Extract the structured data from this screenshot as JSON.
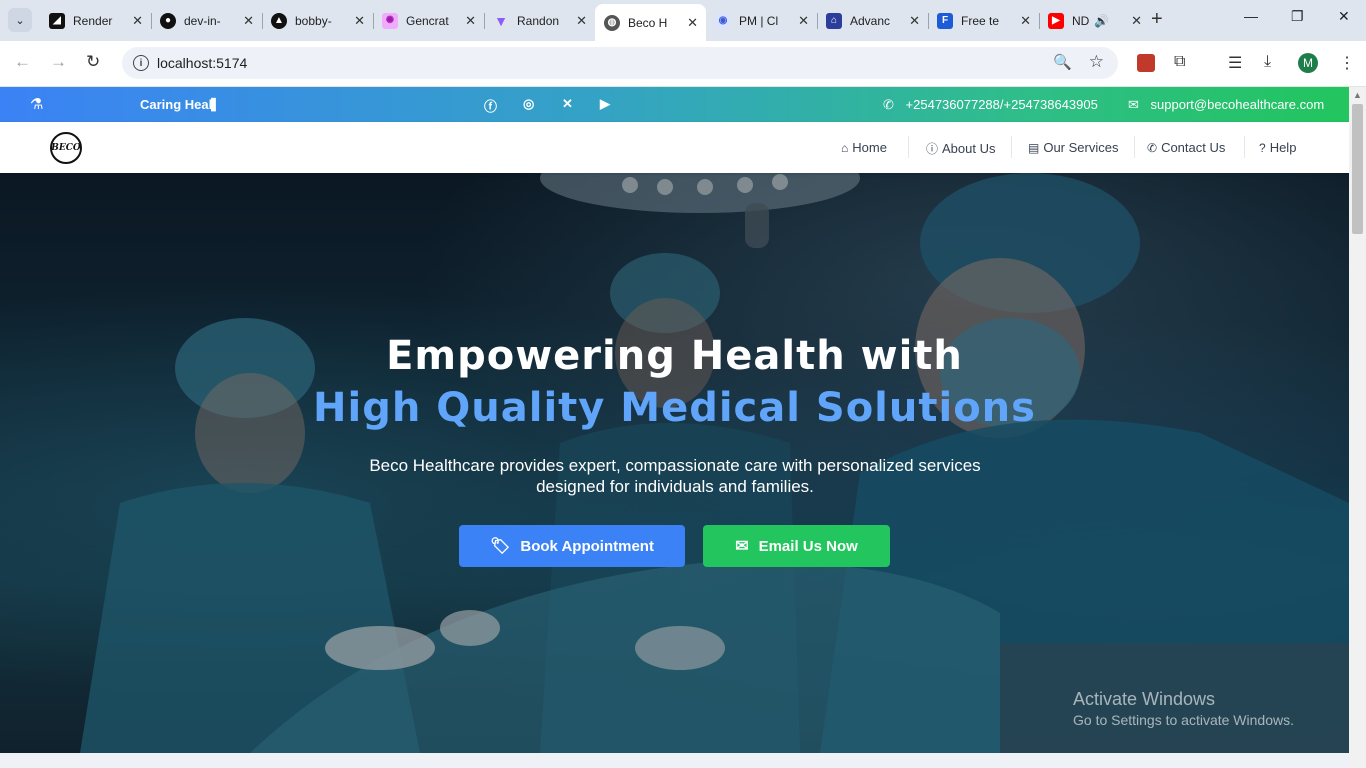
{
  "browser": {
    "tabs": [
      {
        "title": "Render",
        "icon": "render-favicon",
        "color": "#111111"
      },
      {
        "title": "dev-in-",
        "icon": "github-favicon",
        "color": "#111111"
      },
      {
        "title": "bobby-",
        "icon": "vercel-favicon",
        "color": "#111111"
      },
      {
        "title": "Gencrat",
        "icon": "octopus-favicon",
        "color": "#d946ef"
      },
      {
        "title": "Randon",
        "icon": "vite-favicon",
        "color": "#8b5cf6"
      },
      {
        "title": "Beco H",
        "icon": "globe-favicon",
        "color": "#555555",
        "active": true
      },
      {
        "title": "PM | Cl",
        "icon": "search-favicon",
        "color": "#3b5bdb"
      },
      {
        "title": "Advanc",
        "icon": "advance-favicon",
        "color": "#2c3e9c"
      },
      {
        "title": "Free te",
        "icon": "forms-favicon",
        "color": "#1e5bd6"
      },
      {
        "title": "ND",
        "icon": "youtube-favicon",
        "color": "#ff0000"
      }
    ],
    "url": "localhost:5174",
    "profile_initial": "M"
  },
  "topbar": {
    "ticker": "Caring Heal",
    "phone": "+254736077288/+254738643905",
    "email": "support@becohealthcare.com",
    "socials": [
      "facebook-icon",
      "instagram-icon",
      "x-icon",
      "youtube-icon"
    ]
  },
  "navbar": {
    "logo_text": "BECO",
    "links": [
      {
        "label": "Home",
        "icon": "home-icon"
      },
      {
        "label": "About Us",
        "icon": "info-icon"
      },
      {
        "label": "Our Services",
        "icon": "book-icon"
      },
      {
        "label": "Contact Us",
        "icon": "phone-icon"
      },
      {
        "label": "Help",
        "icon": "question-icon"
      }
    ]
  },
  "hero": {
    "title_line1": "Empowering Health with",
    "title_line2": "High Quality Medical Solutions",
    "subtitle": "Beco Healthcare provides expert, compassionate care with personalized services designed for individuals and families.",
    "book_button": "Book Appointment",
    "email_button": "Email Us Now"
  },
  "watermark": {
    "line1": "Activate Windows",
    "line2": "Go to Settings to activate Windows."
  },
  "colors": {
    "primary_blue": "#3b82f6",
    "accent_green": "#22c55e",
    "heading_light_blue": "#60a5fa"
  }
}
